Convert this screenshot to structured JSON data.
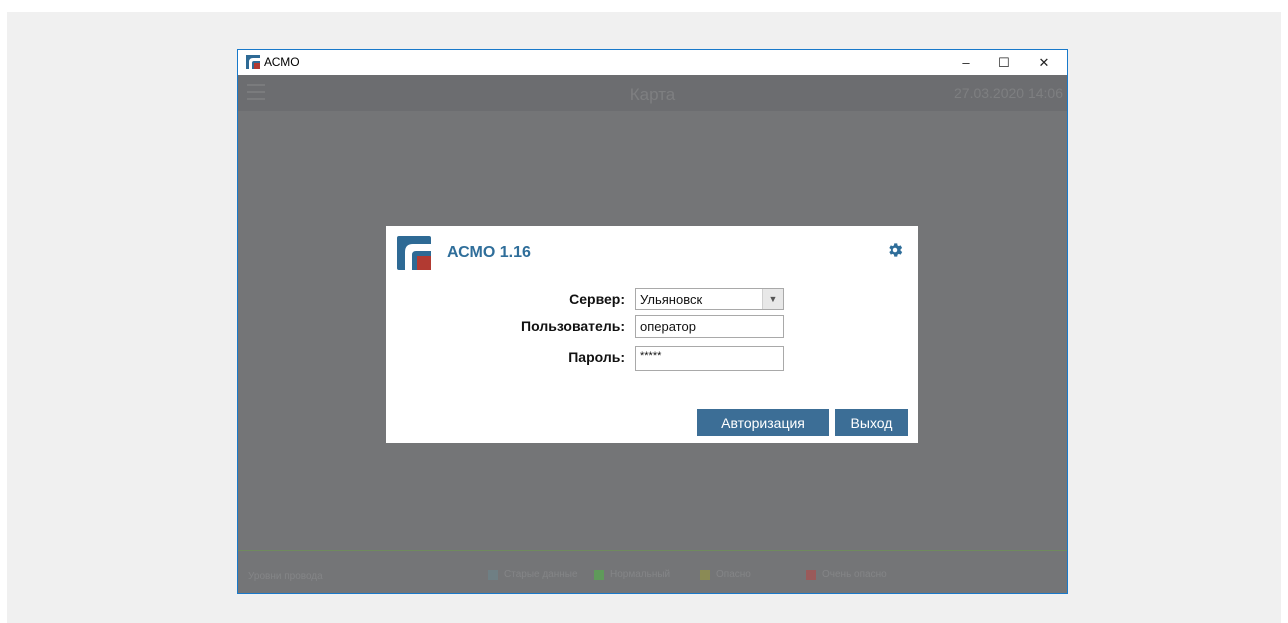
{
  "window": {
    "title": "АСМО",
    "minimize_glyph": "–",
    "maximize_glyph": "☐",
    "close_glyph": "✕"
  },
  "app": {
    "header_title": "Карта",
    "header_datetime": "27.03.2020 14:06",
    "status": {
      "label": "Уровни провода",
      "legend": [
        {
          "label": "Старые данные",
          "color": "#6f7f84"
        },
        {
          "label": "Нормальный",
          "color": "#5f9a5a"
        },
        {
          "label": "Опасно",
          "color": "#8a8a55"
        },
        {
          "label": "Очень опасно",
          "color": "#9a5a5a"
        }
      ]
    }
  },
  "dialog": {
    "title": "АСМО 1.16",
    "server_label": "Сервер:",
    "server_value": "Ульяновск",
    "user_label": "Пользователь:",
    "user_value": "оператор",
    "password_label": "Пароль:",
    "password_value": "*****",
    "login_button": "Авторизация",
    "exit_button": "Выход"
  },
  "colors": {
    "accent": "#3c6e96",
    "title": "#2f6e9a",
    "logo_blue": "#2e6a95",
    "logo_red": "#b23a32",
    "overlay": "#747577"
  }
}
